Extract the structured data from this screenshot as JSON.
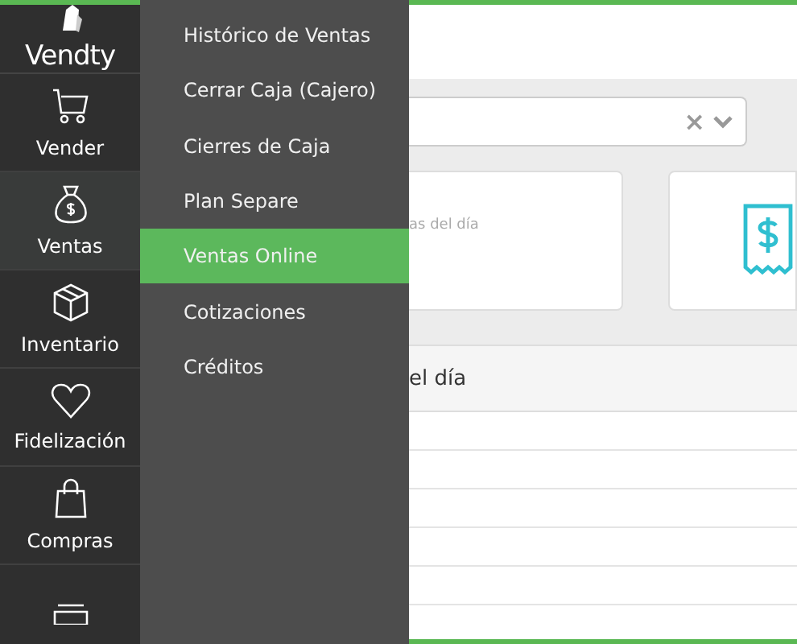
{
  "sidebar": {
    "logo": "Vendty",
    "items": [
      {
        "label": "Vender",
        "kind": "cart",
        "selected": false
      },
      {
        "label": "Ventas",
        "kind": "moneybag",
        "selected": true
      },
      {
        "label": "Inventario",
        "kind": "box",
        "selected": false
      },
      {
        "label": "Fidelización",
        "kind": "heart",
        "selected": false
      },
      {
        "label": "Compras",
        "kind": "bag",
        "selected": false
      },
      {
        "kind": "stack",
        "selected": false
      }
    ]
  },
  "submenu": {
    "items": [
      {
        "label": "Histórico de Ventas",
        "selected": false
      },
      {
        "label": "Cerrar Caja (Cajero)",
        "selected": false
      },
      {
        "label": "Cierres de Caja",
        "selected": false
      },
      {
        "label": "Plan Separe",
        "selected": false
      },
      {
        "label": "Ventas Online",
        "selected": true
      },
      {
        "label": "Cotizaciones",
        "selected": false
      },
      {
        "label": "Créditos",
        "selected": false
      }
    ]
  },
  "content": {
    "select": {
      "clear": "×"
    },
    "cards": [
      {
        "kind": "text",
        "caption": "as del día"
      },
      {
        "kind": "receipt"
      }
    ],
    "table": {
      "title": "el día"
    }
  }
}
